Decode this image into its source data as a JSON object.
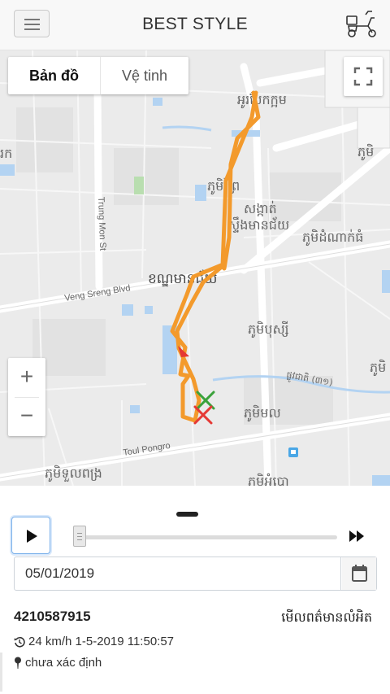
{
  "header": {
    "title": "BEST STYLE",
    "menu_icon": "hamburger-icon",
    "vehicle_icon": "scooter-icon"
  },
  "map": {
    "map_types": [
      {
        "label": "Bản đồ",
        "active": true
      },
      {
        "label": "Vệ tinh",
        "active": false
      }
    ],
    "fullscreen_icon": "fullscreen-icon",
    "zoom_in": "+",
    "zoom_out": "−",
    "labels": {
      "trung_mon": "Trung Mon St",
      "veng_sreng": "Veng Sreng Blvd",
      "toul_pongro": "Toul Pongro",
      "kh1": "អូរបែកក្អម",
      "kh2": "ភូមិព្រៃ",
      "kh3": "សង្កាត់",
      "kh4": "ស្ទឹងមានជ័យ",
      "kh5": "ភូមិដំណាក់ធំ",
      "kh6": "ខណ្ឌមានជ័យ",
      "kh7": "ភូមិបុស្សី",
      "kh8": "ផ្លូវជាតិ (៣១)",
      "kh9": "ភូមិមល",
      "kh10": "ភូមិទួលពង្រ",
      "kh11": "ភូមិ",
      "kh12": "ភូមិ",
      "kh13": "ភូមិអំបោ",
      "kh14": "រក"
    },
    "route_color": "#f39a2c",
    "start_marker_color": "#3ba23b",
    "end_marker_color": "#e53935",
    "direction_arrow_color": "#e53935"
  },
  "playback": {
    "play_icon": "play-icon",
    "fast_forward_icon": "fast-forward-icon",
    "progress": 0.02,
    "date_value": "05/01/2019",
    "calendar_icon": "calendar-icon"
  },
  "device": {
    "id": "4210587915",
    "name": "មើលពត៌មានលំអិត",
    "speed_text": "24 km/h 1-5-2019 11:50:57",
    "location_text": "chưa xác định",
    "history_icon": "history-icon",
    "pin_icon": "map-pin-icon"
  }
}
